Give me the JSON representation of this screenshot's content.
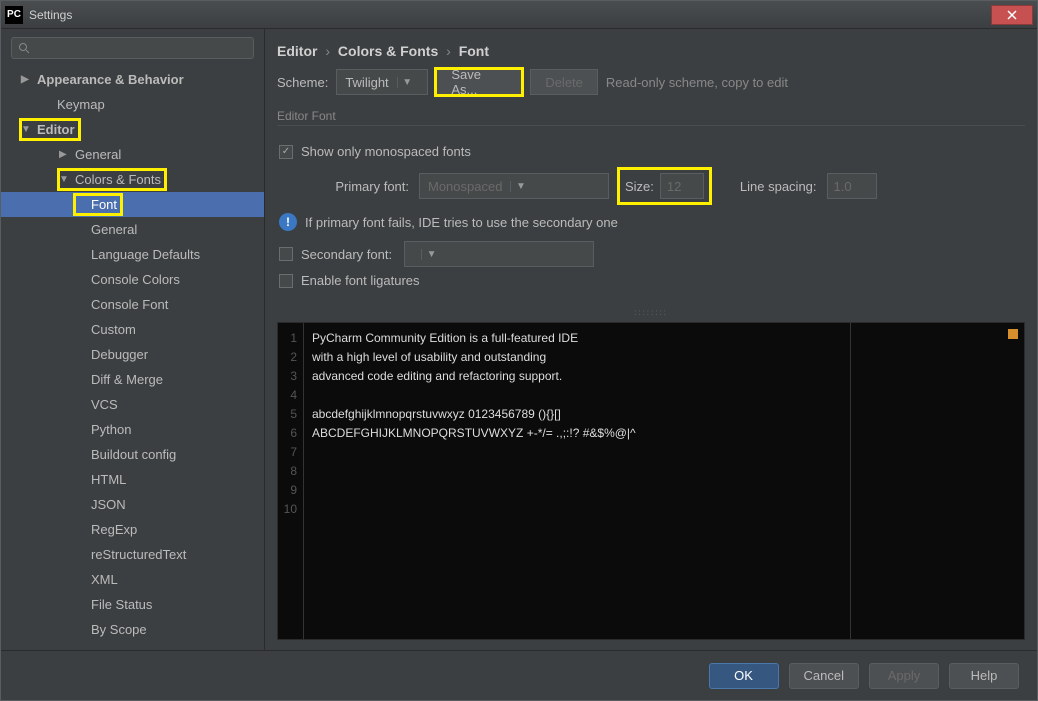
{
  "window": {
    "title": "Settings",
    "icon_text": "PC"
  },
  "search": {
    "placeholder": ""
  },
  "sidebar": {
    "items": [
      {
        "label": "Appearance & Behavior",
        "level": "l1",
        "arrow": "▶",
        "hl": false
      },
      {
        "label": "Keymap",
        "level": "l2",
        "arrow": "",
        "hl": false
      },
      {
        "label": "Editor",
        "level": "l1",
        "arrow": "▼",
        "hl": true
      },
      {
        "label": "General",
        "level": "l3",
        "arrow": "▶",
        "hl": false
      },
      {
        "label": "Colors & Fonts",
        "level": "l3",
        "arrow": "▼",
        "hl": true
      },
      {
        "label": "Font",
        "level": "l4",
        "arrow": "",
        "hl": true,
        "selected": true
      },
      {
        "label": "General",
        "level": "l4",
        "arrow": "",
        "hl": false
      },
      {
        "label": "Language Defaults",
        "level": "l4",
        "arrow": "",
        "hl": false
      },
      {
        "label": "Console Colors",
        "level": "l4",
        "arrow": "",
        "hl": false
      },
      {
        "label": "Console Font",
        "level": "l4",
        "arrow": "",
        "hl": false
      },
      {
        "label": "Custom",
        "level": "l4",
        "arrow": "",
        "hl": false
      },
      {
        "label": "Debugger",
        "level": "l4",
        "arrow": "",
        "hl": false
      },
      {
        "label": "Diff & Merge",
        "level": "l4",
        "arrow": "",
        "hl": false
      },
      {
        "label": "VCS",
        "level": "l4",
        "arrow": "",
        "hl": false
      },
      {
        "label": "Python",
        "level": "l4",
        "arrow": "",
        "hl": false
      },
      {
        "label": "Buildout config",
        "level": "l4",
        "arrow": "",
        "hl": false
      },
      {
        "label": "HTML",
        "level": "l4",
        "arrow": "",
        "hl": false
      },
      {
        "label": "JSON",
        "level": "l4",
        "arrow": "",
        "hl": false
      },
      {
        "label": "RegExp",
        "level": "l4",
        "arrow": "",
        "hl": false
      },
      {
        "label": "reStructuredText",
        "level": "l4",
        "arrow": "",
        "hl": false
      },
      {
        "label": "XML",
        "level": "l4",
        "arrow": "",
        "hl": false
      },
      {
        "label": "File Status",
        "level": "l4",
        "arrow": "",
        "hl": false
      },
      {
        "label": "By Scope",
        "level": "l4",
        "arrow": "",
        "hl": false
      }
    ]
  },
  "breadcrumb": {
    "a": "Editor",
    "b": "Colors & Fonts",
    "c": "Font"
  },
  "scheme": {
    "label": "Scheme:",
    "value": "Twilight",
    "save_as": "Save As...",
    "delete": "Delete",
    "readonly": "Read-only scheme, copy to edit"
  },
  "editorFont": {
    "section": "Editor Font",
    "show_mono": "Show only monospaced fonts",
    "primary_label": "Primary font:",
    "primary_value": "Monospaced",
    "size_label": "Size:",
    "size_value": "12",
    "linespacing_label": "Line spacing:",
    "linespacing_value": "1.0",
    "info": "If primary font fails, IDE tries to use the secondary one",
    "secondary_label": "Secondary font:",
    "ligatures": "Enable font ligatures"
  },
  "preview": {
    "lines": [
      "PyCharm Community Edition is a full-featured IDE",
      "with a high level of usability and outstanding",
      "advanced code editing and refactoring support.",
      "",
      "abcdefghijklmnopqrstuvwxyz 0123456789 (){}[]",
      "ABCDEFGHIJKLMNOPQRSTUVWXYZ +-*/= .,;:!? #&$%@|^",
      "",
      "",
      "",
      ""
    ]
  },
  "footer": {
    "ok": "OK",
    "cancel": "Cancel",
    "apply": "Apply",
    "help": "Help"
  }
}
